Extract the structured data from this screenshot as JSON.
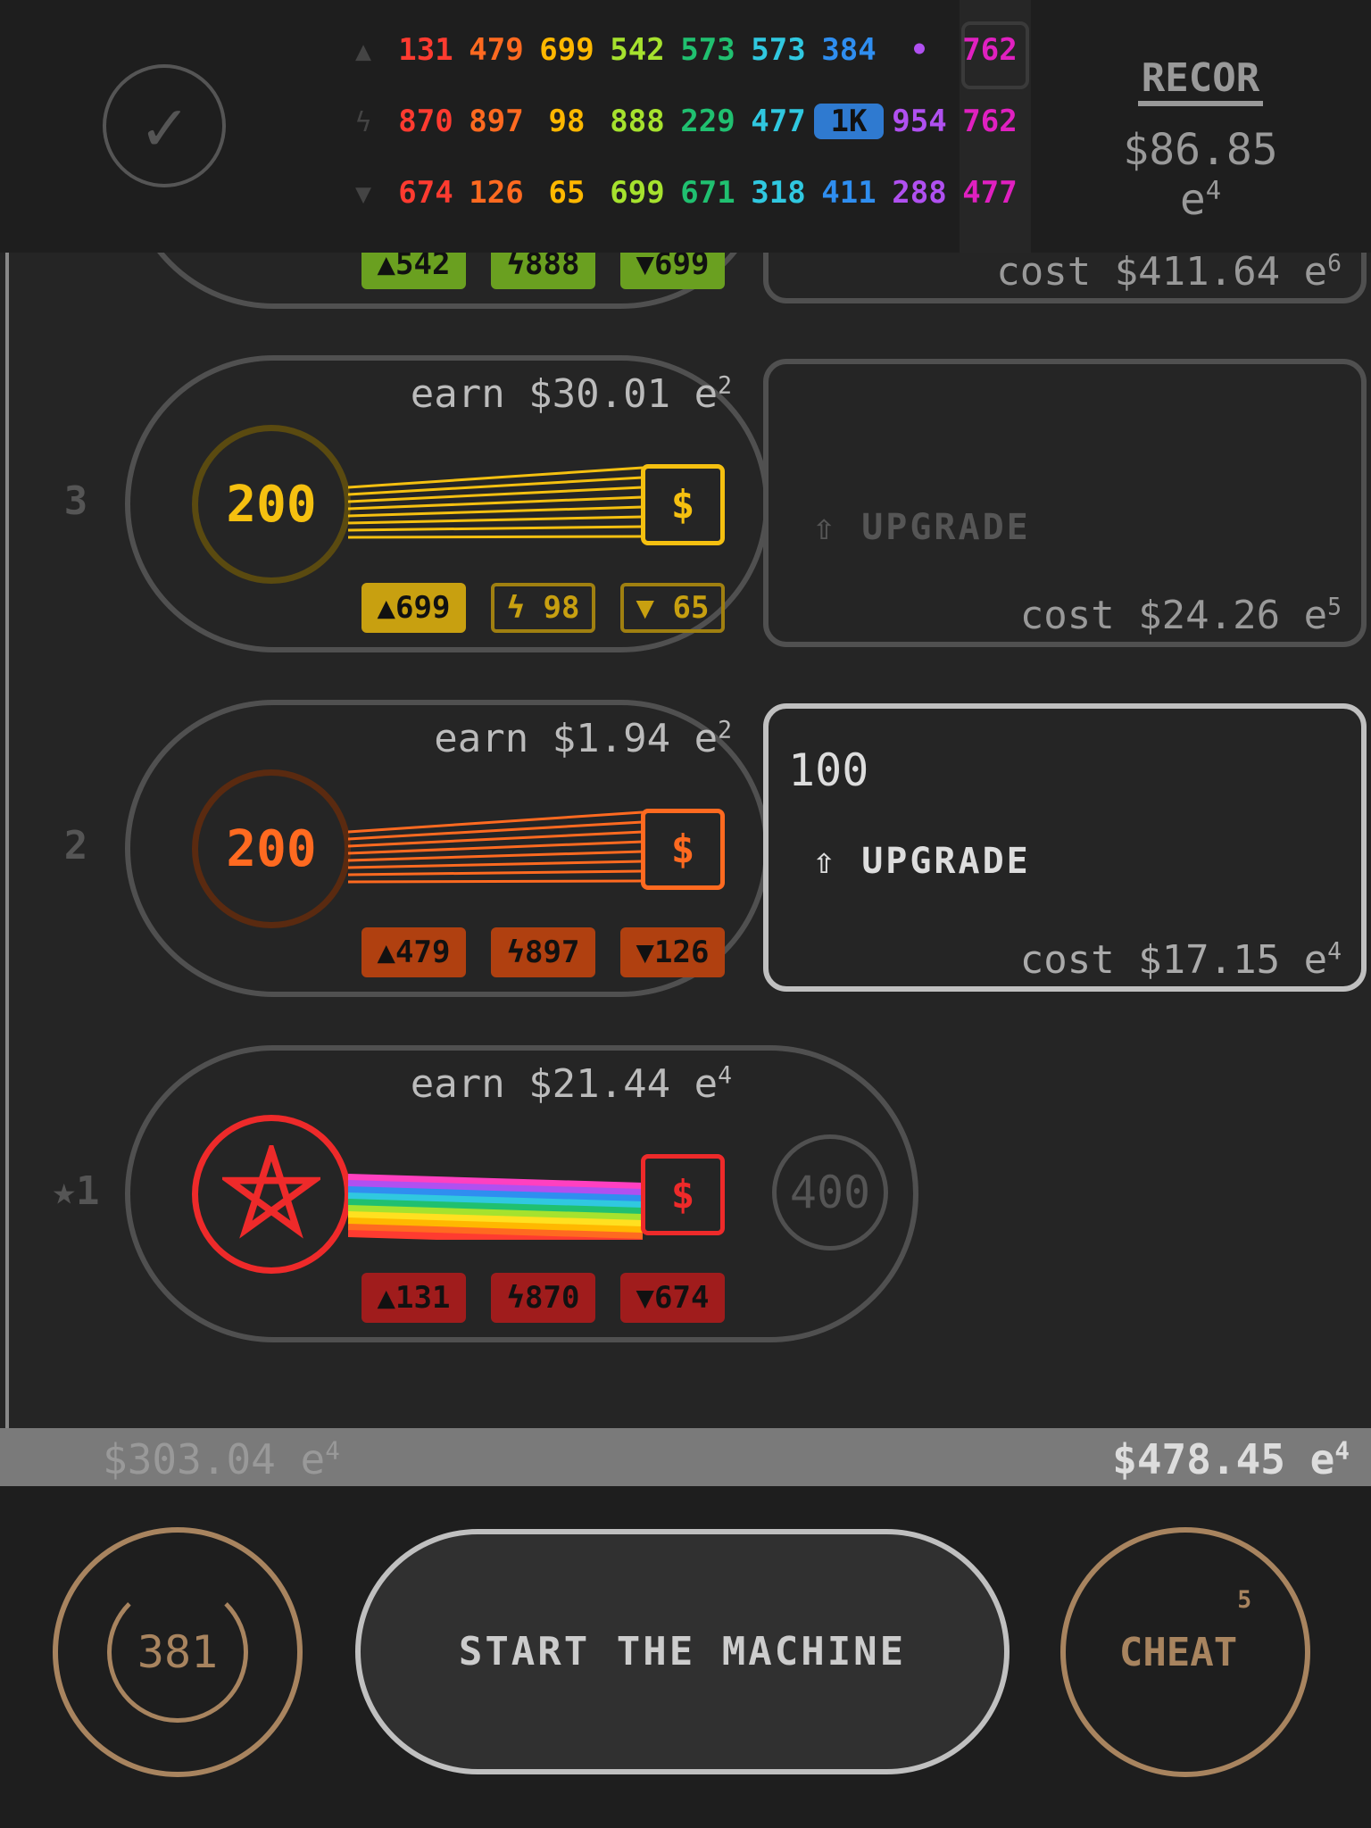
{
  "stats": {
    "row_icons": [
      "up-triangle-icon",
      "lightning-icon",
      "down-triangle-icon"
    ],
    "colors": [
      "#ff3b30",
      "#ff6a20",
      "#ffb800",
      "#a6e22e",
      "#20c070",
      "#30c8e0",
      "#2f8ef0",
      "#b050f0",
      "#e020c0"
    ],
    "rows": [
      [
        "131",
        "479",
        "699",
        "542",
        "573",
        "573",
        "384",
        "•",
        "762"
      ],
      [
        "870",
        "897",
        "98",
        "888",
        "229",
        "477",
        "1K",
        "954",
        "762"
      ],
      [
        "674",
        "126",
        "65",
        "699",
        "671",
        "318",
        "411",
        "288",
        "477"
      ]
    ]
  },
  "record": {
    "label": "RECOR",
    "value": "$86.85 e",
    "exp": "4"
  },
  "machines": [
    {
      "num": "",
      "earn": "",
      "level": "",
      "color": "#6aa020",
      "dark": "#3a5a10",
      "badges": [
        "▲542",
        "ϟ888",
        "▼699"
      ],
      "cost": "cost $411.64 e",
      "cost_exp": "6",
      "upgrade_level": "",
      "upgrade": ""
    },
    {
      "num": "3",
      "earn": "earn $30.01 e",
      "earn_exp": "2",
      "level": "200",
      "color": "#f5c010",
      "dark": "#5a4a10",
      "badges": [
        "▲699",
        "ϟ 98",
        "▼ 65"
      ],
      "cost": "cost $24.26 e",
      "cost_exp": "5",
      "upgrade_level": "",
      "upgrade": "UPGRADE"
    },
    {
      "num": "2",
      "earn": "earn $1.94 e",
      "earn_exp": "2",
      "level": "200",
      "color": "#ff6a20",
      "dark": "#5a2a10",
      "badges": [
        "▲479",
        "ϟ897",
        "▼126"
      ],
      "cost": "cost $17.15 e",
      "cost_exp": "4",
      "upgrade_level": "100",
      "upgrade": "UPGRADE"
    },
    {
      "num": "★1",
      "earn": "earn $21.44 e",
      "earn_exp": "4",
      "level": "pentagram-icon",
      "color": "#ee2a2a",
      "dark": "#ee2a2a",
      "badges": [
        "▲131",
        "ϟ870",
        "▼674"
      ],
      "next_level": "400"
    }
  ],
  "status": {
    "left": "$303.04 e",
    "left_exp": "4",
    "right": "$478.45 e",
    "right_exp": "4"
  },
  "controls": {
    "timer": "381",
    "start": "START THE MACHINE",
    "cheat": "CHEAT",
    "cheat_exp": "5"
  }
}
